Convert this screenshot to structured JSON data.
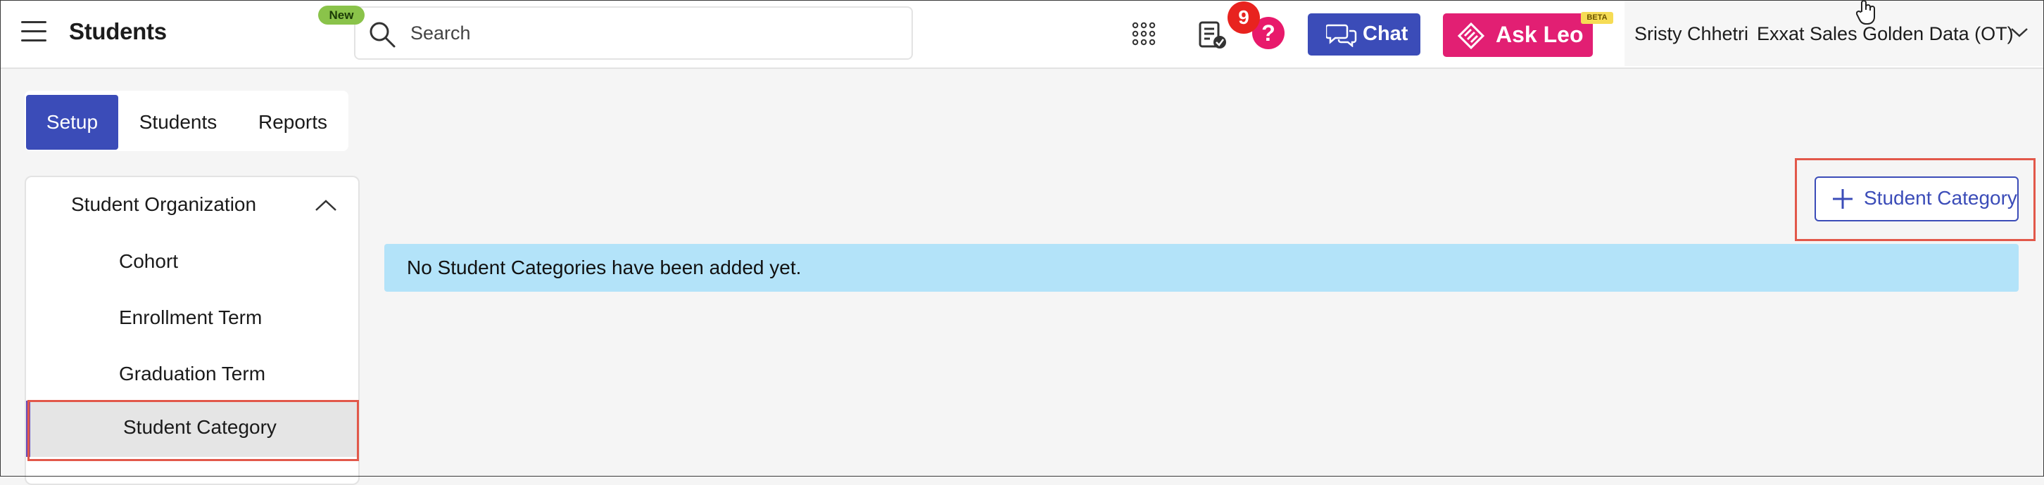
{
  "header": {
    "app_title": "Students",
    "new_badge": "New",
    "search_placeholder": "Search",
    "notification_count": "9",
    "help_label": "?",
    "chat_label": "Chat",
    "ask_leo_label": "Ask Leo",
    "beta_badge": "BETA",
    "user_name": "Sristy Chhetri",
    "org_name": "Exxat Sales Golden Data (OT)"
  },
  "tabs": [
    {
      "label": "Setup",
      "active": true
    },
    {
      "label": "Students",
      "active": false
    },
    {
      "label": "Reports",
      "active": false
    }
  ],
  "sidebar": {
    "section_label": "Student Organization",
    "items": [
      {
        "label": "Cohort"
      },
      {
        "label": "Enrollment Term"
      },
      {
        "label": "Graduation Term"
      },
      {
        "label": "Student Category",
        "selected": true
      }
    ]
  },
  "main": {
    "add_button_label": "Student Category",
    "empty_message": "No Student Categories have been added yet."
  },
  "colors": {
    "primary": "#3b4cb8",
    "ask_leo": "#e21f73",
    "notification": "#e8231f",
    "info_banner": "#b3e3f9",
    "highlight": "#e2584a"
  },
  "icons": [
    "hamburger-icon",
    "search-icon",
    "apps-grid-icon",
    "task-list-icon",
    "help-icon",
    "chat-bubbles-icon",
    "leo-logo-icon",
    "chevron-down-icon",
    "chevron-up-icon",
    "plus-icon",
    "hand-cursor-icon"
  ]
}
